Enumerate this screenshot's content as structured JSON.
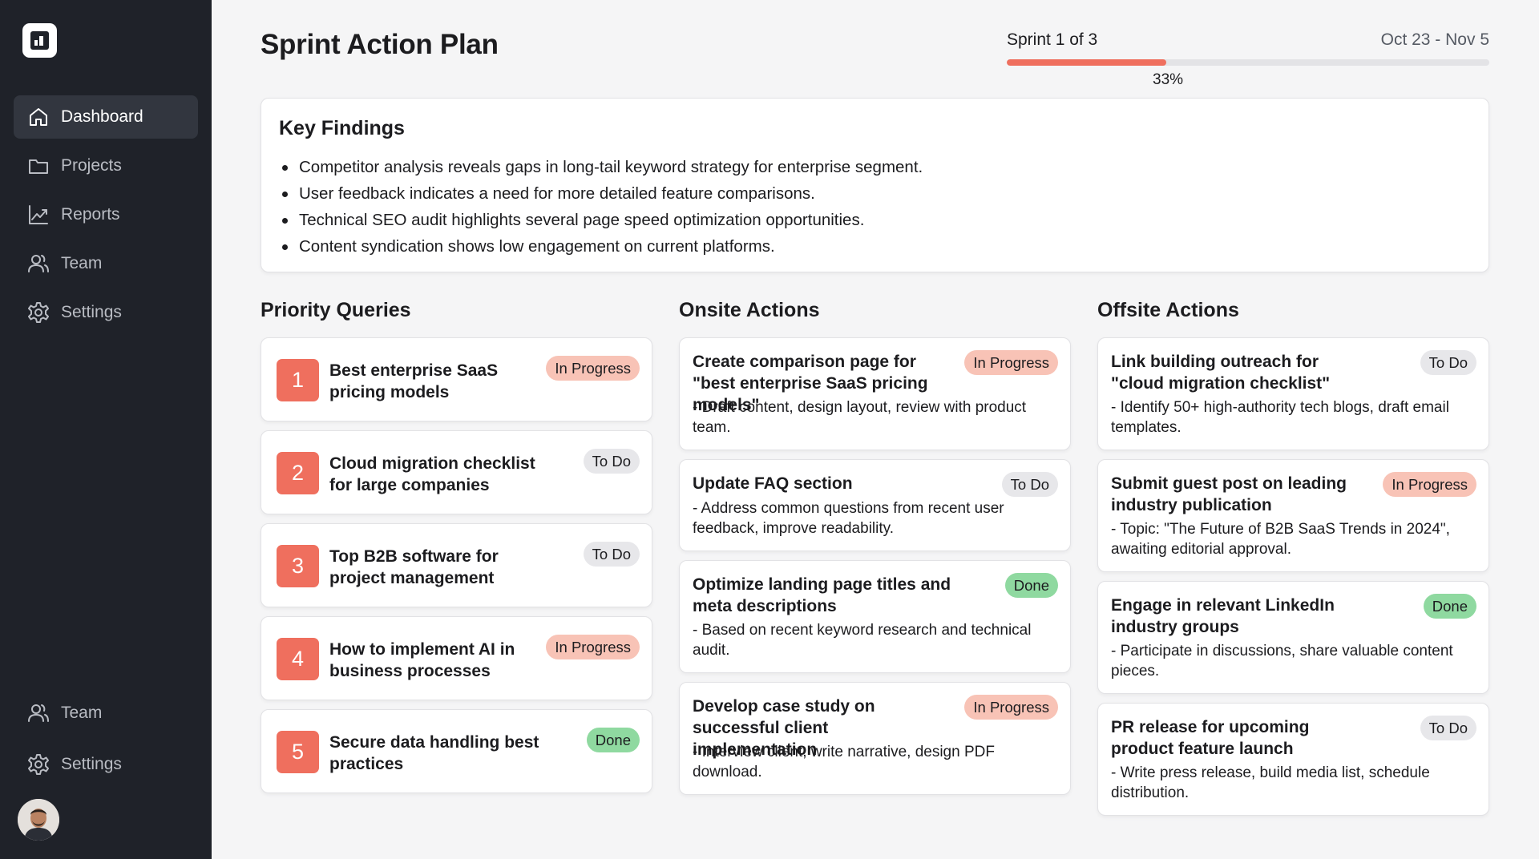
{
  "app": {
    "logo": "bar-chart-logo-icon"
  },
  "sidebar": {
    "top_items": [
      {
        "label": "Dashboard",
        "icon": "home-icon",
        "active": true
      },
      {
        "label": "Projects",
        "icon": "folder-icon"
      },
      {
        "label": "Reports",
        "icon": "line-chart-icon"
      },
      {
        "label": "Team",
        "icon": "users-icon"
      },
      {
        "label": "Settings",
        "icon": "gear-icon"
      }
    ],
    "bottom_items": [
      {
        "label": "Team",
        "icon": "users-icon"
      },
      {
        "label": "Settings",
        "icon": "gear-icon"
      }
    ],
    "avatar": "user-avatar"
  },
  "header": {
    "title": "Sprint Action Plan",
    "sprint_label": "Sprint 1 of 3",
    "dates": "Oct 23 - Nov 5",
    "progress_percent": 33,
    "progress_text": "33%"
  },
  "findings": {
    "title": "Key Findings",
    "items": [
      "Competitor analysis reveals gaps in long-tail keyword strategy for enterprise segment.",
      "User feedback indicates a need for more detailed feature comparisons.",
      "Technical SEO audit highlights several page speed optimization opportunities.",
      "Content syndication shows low engagement on current platforms."
    ]
  },
  "priority": {
    "title": "Priority Queries",
    "items": [
      {
        "num": "1",
        "title": "Best enterprise SaaS pricing models",
        "status": "In Progress"
      },
      {
        "num": "2",
        "title": "Cloud migration checklist for large companies",
        "status": "To Do"
      },
      {
        "num": "3",
        "title": "Top B2B software for project management",
        "status": "To Do"
      },
      {
        "num": "4",
        "title": "How to implement AI in business processes",
        "status": "In Progress"
      },
      {
        "num": "5",
        "title": "Secure data handling best practices",
        "status": "Done"
      }
    ]
  },
  "onsite": {
    "title": "Onsite Actions",
    "items": [
      {
        "title": "Create comparison page for \"best enterprise SaaS pricing models\"",
        "desc": "- Draft content, design layout, review with product team.",
        "status": "In Progress"
      },
      {
        "title": "Update FAQ section",
        "desc": "- Address common questions from recent user feedback, improve readability.",
        "status": "To Do"
      },
      {
        "title": "Optimize landing page titles and meta descriptions",
        "desc": "- Based on recent keyword research and technical audit.",
        "status": "Done"
      },
      {
        "title": "Develop case study on successful client implementation",
        "desc": "- Interview client, write narrative, design PDF download.",
        "status": "In Progress"
      }
    ]
  },
  "offsite": {
    "title": "Offsite Actions",
    "items": [
      {
        "title": "Link building outreach for \"cloud migration checklist\"",
        "desc": "- Identify 50+ high-authority tech blogs, draft email templates.",
        "status": "To Do"
      },
      {
        "title": "Submit guest post on leading industry publication",
        "desc": "- Topic: \"The Future of B2B SaaS Trends in 2024\", awaiting editorial approval.",
        "status": "In Progress"
      },
      {
        "title": "Engage in relevant LinkedIn industry groups",
        "desc": "- Participate in discussions, share valuable content pieces.",
        "status": "Done"
      },
      {
        "title": "PR release for upcoming product feature launch",
        "desc": "- Write press release, build media list, schedule distribution.",
        "status": "To Do"
      }
    ]
  },
  "colors": {
    "sidebar_bg": "#1f2229",
    "accent": "#ef6f5e",
    "in_progress": "#f8c3b6",
    "to_do": "#e7e7ea",
    "done": "#8fd9a0"
  }
}
